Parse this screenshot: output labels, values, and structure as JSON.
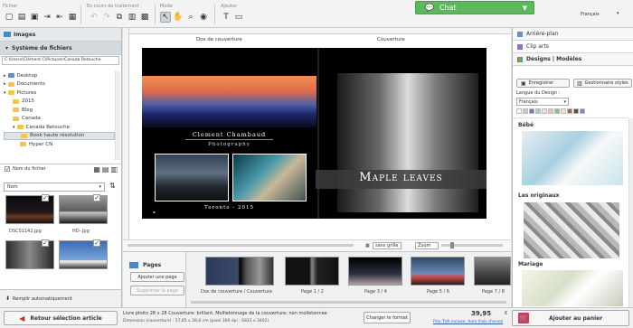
{
  "toolbar": {
    "groups": [
      "Fichier",
      "En cours de traitement",
      "Mode",
      "Ajouter"
    ]
  },
  "chat": {
    "label": "Chat"
  },
  "language": "Français",
  "left": {
    "images_title": "Images",
    "fs_title": "Système de fichiers",
    "path": "C:\\Users\\Clément C\\Pictures\\Canada Retouche",
    "tree": [
      "Desktop",
      "Documents",
      "Pictures",
      "2015",
      "Blog",
      "Canada",
      "Canada Retouche",
      "Book haute résolution",
      "Hyper CN"
    ],
    "sort_label": "Nom du fichier",
    "sort_value": "Nom",
    "thumbs": [
      "DSC01142.jpg",
      "HD-.jpg"
    ],
    "auto_fill": "Remplir automatiquement"
  },
  "canvas": {
    "back_label": "Dos de couverture",
    "front_label": "Couverture",
    "back_title": "Clement Chambaud",
    "back_subtitle": "Photography",
    "back_place": "Toronto - 2015",
    "front_title": "Maple leaves",
    "grid": "sans grille",
    "zoom": "Zoom"
  },
  "pages": {
    "title": "Pages",
    "add": "Ajouter une page",
    "remove": "Supprimer la page",
    "cover": "Dos de couverture / Couverture",
    "labels": [
      "Page 1 / 2",
      "Page 3 / 4",
      "Page 5 / 6",
      "Page 7 / 8"
    ]
  },
  "right": {
    "background": "Arrière-plan",
    "clipart": "Clip arts",
    "designs": "Designs | Modèles",
    "save": "Enregistrer",
    "manage": "Gestionnaire styles",
    "lang_label": "Langue du Design :",
    "lang_value": "Français",
    "cats": [
      "Bébé",
      "Les originaux",
      "Mariage"
    ],
    "swatches": [
      "#ffffff",
      "#c8c8c8",
      "#6b7fa8",
      "#a8c8d8",
      "#f8d8e0",
      "#e0c8a8",
      "#90b898",
      "#f0e8c8",
      "#a06848",
      "#505050",
      "#7888b8"
    ]
  },
  "bottom": {
    "return": "Retour sélection article",
    "desc": "Livre photo 28 x 28 Couverture: brillant, Mollletonnage de la couverture: non molletonnée",
    "dims": "Dimension (couverture) : 57,85 x 28,8 cm (pixel 300 dpi : 6833 x 3402)",
    "change": "Changer le format",
    "price": "39,95",
    "currency": "€",
    "tax": "Prix TVA incluse, hors frais d'envoi",
    "cart": "Ajouter au panier"
  }
}
